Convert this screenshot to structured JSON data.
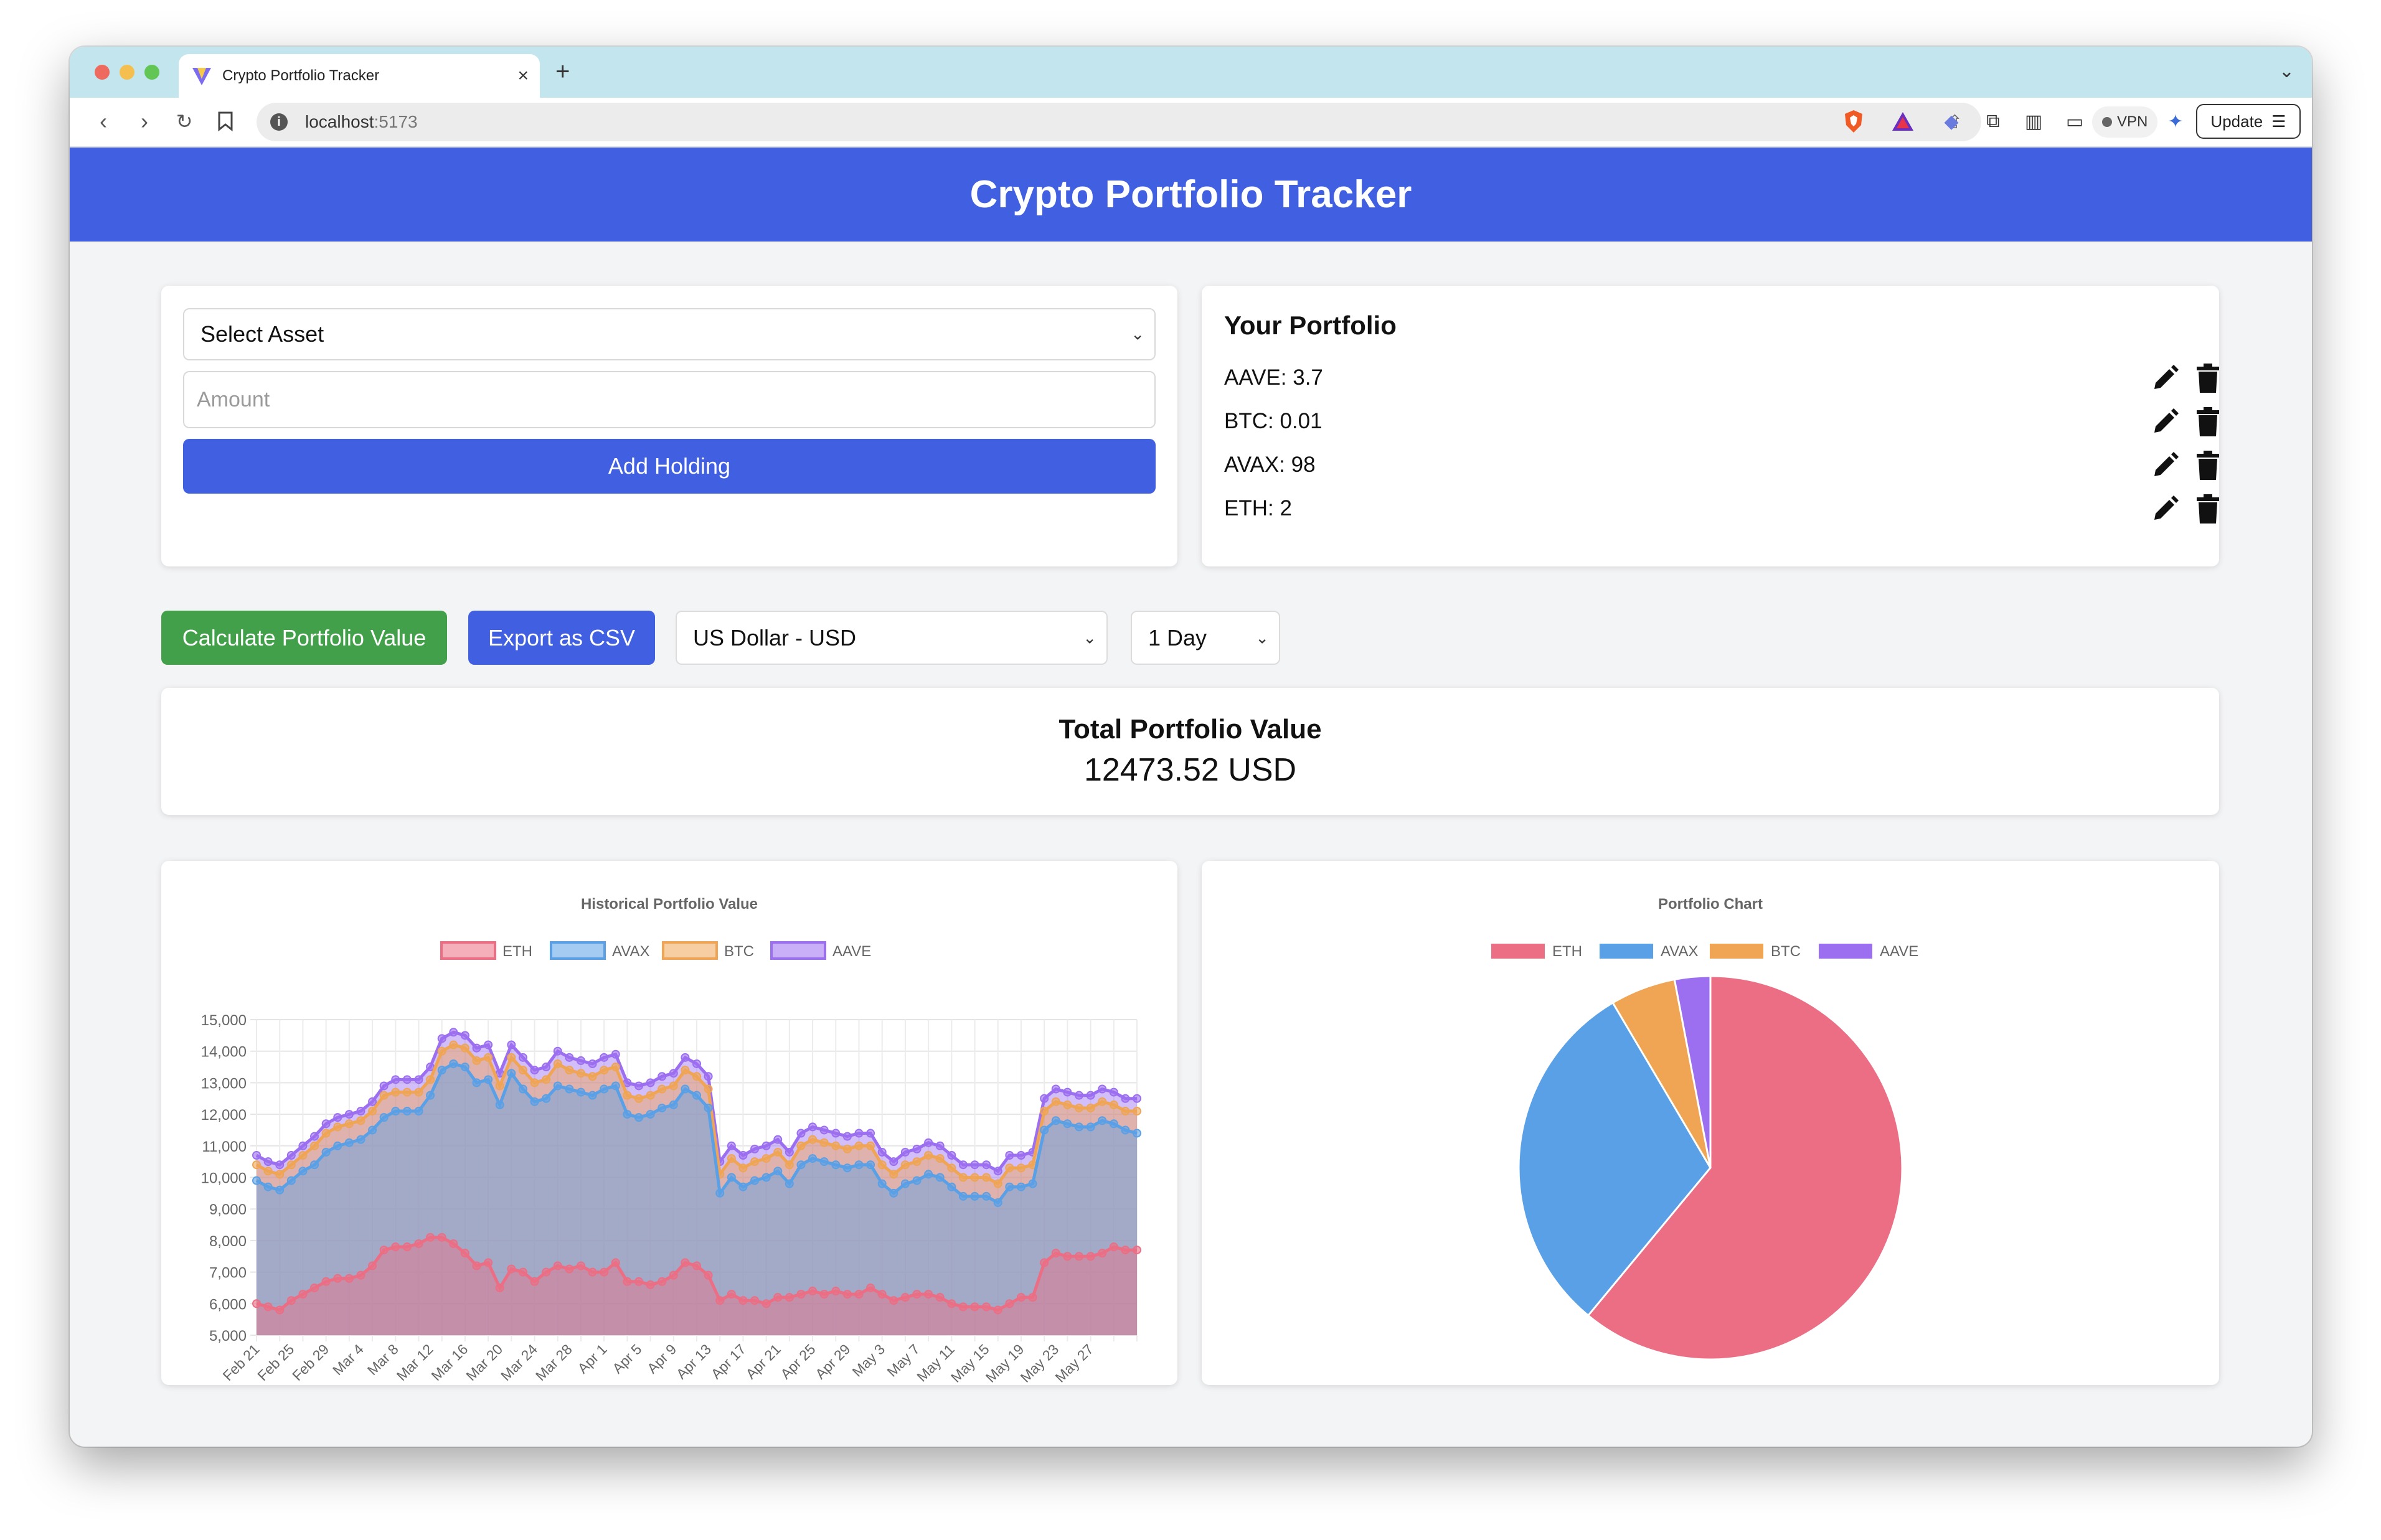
{
  "browser": {
    "tab_title": "Crypto Portfolio Tracker",
    "tab_close": "×",
    "new_tab": "+",
    "url_host": "localhost",
    "url_port": ":5173",
    "vpn_label": "VPN",
    "update_label": "Update"
  },
  "header": {
    "title": "Crypto Portfolio Tracker"
  },
  "add_form": {
    "asset_select": "Select Asset",
    "amount_placeholder": "Amount",
    "add_button": "Add Holding"
  },
  "portfolio": {
    "title": "Your Portfolio",
    "holdings": [
      {
        "label": "AAVE: 3.7"
      },
      {
        "label": "BTC: 0.01"
      },
      {
        "label": "AVAX: 98"
      },
      {
        "label": "ETH: 2"
      }
    ]
  },
  "controls": {
    "calculate_button": "Calculate Portfolio Value",
    "export_button": "Export as CSV",
    "currency_select": "US Dollar - USD",
    "range_select": "1 Day"
  },
  "total": {
    "title": "Total Portfolio Value",
    "value": "12473.52 USD"
  },
  "colors": {
    "ETH": "#ec6e84",
    "AVAX": "#5aa0e6",
    "BTC": "#f0a555",
    "AAVE": "#9c6ef0",
    "primary": "#4060e1",
    "success": "#43a04a"
  },
  "chart_data": [
    {
      "type": "area",
      "title": "Historical Portfolio Value",
      "stacked": true,
      "ylim": [
        5000,
        15000
      ],
      "yticks": [
        "5,000",
        "6,000",
        "7,000",
        "8,000",
        "9,000",
        "10,000",
        "11,000",
        "12,000",
        "13,000",
        "14,000",
        "15,000"
      ],
      "xtick_labels": [
        "Feb 21",
        "Feb 25",
        "Feb 29",
        "Mar 4",
        "Mar 8",
        "Mar 12",
        "Mar 16",
        "Mar 20",
        "Mar 24",
        "Mar 28",
        "Apr 1",
        "Apr 5",
        "Apr 9",
        "Apr 13",
        "Apr 17",
        "Apr 21",
        "Apr 25",
        "Apr 29",
        "May 3",
        "May 7",
        "May 11",
        "May 15",
        "May 19",
        "May 23",
        "May 27"
      ],
      "legend": [
        "ETH",
        "AVAX",
        "BTC",
        "AAVE"
      ],
      "legend_position": "top",
      "x_start": "Feb 21",
      "series": [
        {
          "name": "ETH",
          "values": [
            6000,
            5900,
            5800,
            6100,
            6300,
            6500,
            6700,
            6800,
            6800,
            6900,
            7200,
            7700,
            7800,
            7800,
            7900,
            8100,
            8100,
            7900,
            7600,
            7200,
            7300,
            6500,
            7100,
            7000,
            6700,
            7000,
            7200,
            7100,
            7200,
            7000,
            7000,
            7300,
            6700,
            6700,
            6600,
            6700,
            6900,
            7300,
            7200,
            6900,
            6100,
            6300,
            6100,
            6100,
            6000,
            6200,
            6200,
            6300,
            6400,
            6300,
            6400,
            6300,
            6300,
            6500,
            6300,
            6100,
            6200,
            6300,
            6300,
            6200,
            6000,
            5900,
            5900,
            5900,
            5800,
            6000,
            6200,
            6200,
            7300,
            7600,
            7500,
            7500,
            7500,
            7600,
            7800,
            7700,
            7700
          ]
        },
        {
          "name": "AVAX",
          "values": [
            9900,
            9700,
            9600,
            9900,
            10200,
            10400,
            10800,
            11000,
            11100,
            11200,
            11500,
            11900,
            12100,
            12100,
            12100,
            12600,
            13400,
            13600,
            13500,
            13000,
            13100,
            12300,
            13300,
            12800,
            12400,
            12500,
            12900,
            12800,
            12700,
            12600,
            12800,
            12900,
            12000,
            11900,
            12000,
            12200,
            12300,
            12800,
            12600,
            12200,
            9500,
            10000,
            9700,
            9900,
            10000,
            10200,
            9800,
            10400,
            10600,
            10500,
            10400,
            10300,
            10400,
            10400,
            9800,
            9500,
            9800,
            9900,
            10100,
            10000,
            9700,
            9400,
            9400,
            9400,
            9200,
            9700,
            9700,
            9800,
            11500,
            11800,
            11700,
            11600,
            11600,
            11800,
            11700,
            11500,
            11400
          ]
        },
        {
          "name": "BTC",
          "values": [
            10400,
            10200,
            10100,
            10400,
            10700,
            11000,
            11400,
            11600,
            11700,
            11800,
            12100,
            12600,
            12700,
            12700,
            12700,
            13100,
            14000,
            14200,
            14100,
            13700,
            13800,
            12900,
            13800,
            13400,
            13000,
            13100,
            13600,
            13400,
            13300,
            13200,
            13400,
            13500,
            12600,
            12500,
            12600,
            12800,
            12900,
            13400,
            13200,
            12800,
            10100,
            10600,
            10300,
            10500,
            10600,
            10800,
            10400,
            11000,
            11200,
            11100,
            11000,
            10900,
            11000,
            11000,
            10400,
            10100,
            10400,
            10500,
            10700,
            10600,
            10300,
            10000,
            10000,
            10000,
            9800,
            10300,
            10300,
            10400,
            12100,
            12400,
            12300,
            12200,
            12200,
            12400,
            12300,
            12100,
            12100
          ]
        },
        {
          "name": "AAVE",
          "values": [
            10700,
            10500,
            10400,
            10700,
            11000,
            11300,
            11700,
            11900,
            12000,
            12100,
            12400,
            12900,
            13100,
            13100,
            13100,
            13500,
            14400,
            14600,
            14500,
            14100,
            14200,
            13300,
            14200,
            13800,
            13400,
            13500,
            14000,
            13800,
            13700,
            13600,
            13800,
            13900,
            13000,
            12900,
            13000,
            13200,
            13300,
            13800,
            13600,
            13200,
            10500,
            11000,
            10700,
            10900,
            11000,
            11200,
            10800,
            11400,
            11600,
            11500,
            11400,
            11300,
            11400,
            11400,
            10800,
            10500,
            10800,
            10900,
            11100,
            11000,
            10700,
            10400,
            10400,
            10400,
            10200,
            10700,
            10700,
            10800,
            12500,
            12800,
            12700,
            12600,
            12600,
            12800,
            12700,
            12500,
            12500
          ]
        }
      ]
    },
    {
      "type": "pie",
      "title": "Portfolio Chart",
      "legend": [
        "ETH",
        "AVAX",
        "BTC",
        "AAVE"
      ],
      "legend_position": "top",
      "categories": [
        "ETH",
        "AVAX",
        "BTC",
        "AAVE"
      ],
      "values": [
        61.0,
        30.5,
        5.5,
        3.0
      ]
    }
  ]
}
